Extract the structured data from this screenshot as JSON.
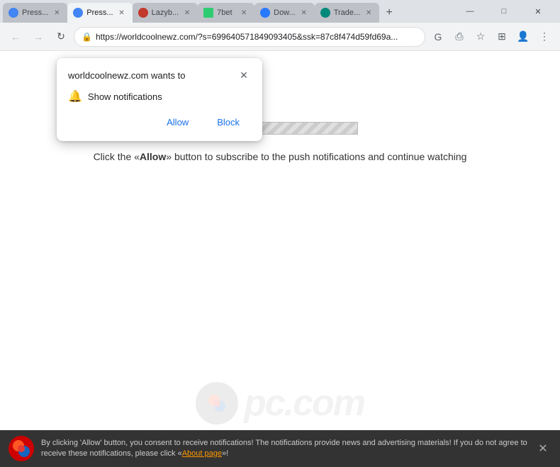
{
  "browser": {
    "tabs": [
      {
        "id": "tab1",
        "label": "Press...",
        "active": false,
        "favicon_color": "#4285f4"
      },
      {
        "id": "tab2",
        "label": "Press...",
        "active": true,
        "favicon_color": "#4285f4"
      },
      {
        "id": "tab3",
        "label": "Lazyb...",
        "active": false,
        "favicon_color": "#c0392b"
      },
      {
        "id": "tab4",
        "label": "7bet",
        "active": false,
        "favicon_color": "#2ecc71"
      },
      {
        "id": "tab5",
        "label": "Dow...",
        "active": false,
        "favicon_color": "#2979ff"
      },
      {
        "id": "tab6",
        "label": "Trade...",
        "active": false,
        "favicon_color": "#00897b"
      }
    ],
    "new_tab_label": "+",
    "window_controls": {
      "minimize": "—",
      "maximize": "□",
      "close": "✕"
    },
    "url": "https://worldcoolnewz.com/?s=699640571849093405&ssk=87c8f474d59fd69a...",
    "nav": {
      "back": "←",
      "forward": "→",
      "refresh": "↻"
    }
  },
  "popup": {
    "title": "worldcoolnewz.com wants to",
    "close_icon": "✕",
    "body_text": "Show notifications",
    "allow_label": "Allow",
    "block_label": "Block"
  },
  "page": {
    "instruction_prefix": "Click the «",
    "instruction_bold": "Allow",
    "instruction_suffix": "» button to subscribe to the push notifications and continue watching"
  },
  "bottom_bar": {
    "text": "By clicking 'Allow' button, you consent to receive notifications! The notifications provide news and advertising materials! If you do not agree to receive these notifications, please click «",
    "link_text": "About page",
    "text_suffix": "»!",
    "close_icon": "✕"
  }
}
